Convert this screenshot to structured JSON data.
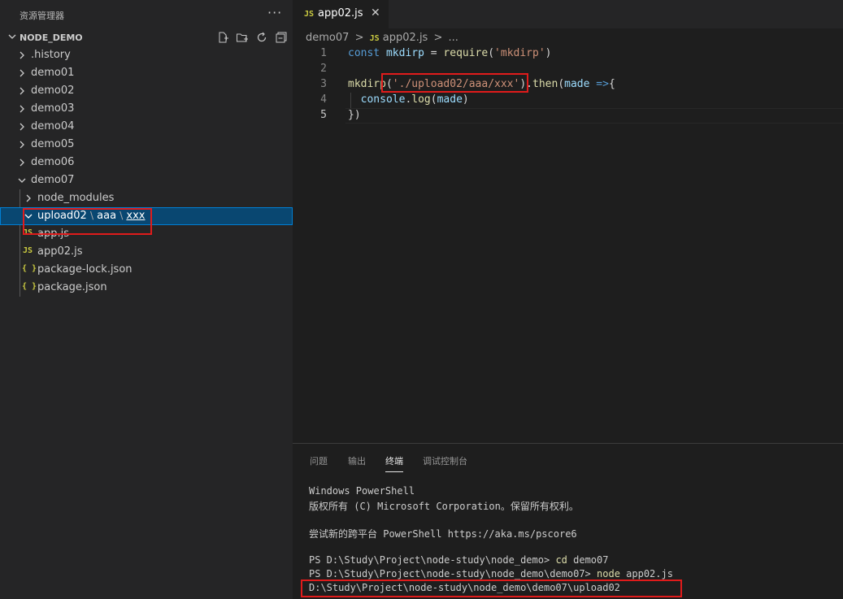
{
  "sidebar": {
    "title": "资源管理器",
    "more": "···",
    "section_title": "NODE_DEMO",
    "actions": [
      "new-file-icon",
      "new-folder-icon",
      "refresh-icon",
      "collapse-all-icon"
    ],
    "items": [
      {
        "label": ".history",
        "type": "folder",
        "expanded": false
      },
      {
        "label": "demo01",
        "type": "folder",
        "expanded": false
      },
      {
        "label": "demo02",
        "type": "folder",
        "expanded": false
      },
      {
        "label": "demo03",
        "type": "folder",
        "expanded": false
      },
      {
        "label": "demo04",
        "type": "folder",
        "expanded": false
      },
      {
        "label": "demo05",
        "type": "folder",
        "expanded": false
      },
      {
        "label": "demo06",
        "type": "folder",
        "expanded": false
      },
      {
        "label": "demo07",
        "type": "folder",
        "expanded": true
      },
      {
        "label": "node_modules",
        "type": "folder",
        "expanded": false
      },
      {
        "label": "upload02",
        "sep1": "\\",
        "label2": "aaa",
        "sep2": "\\",
        "label3": "xxx",
        "type": "folder",
        "expanded": true,
        "selected": true
      },
      {
        "label": "app.js",
        "type": "file",
        "icon": "JS"
      },
      {
        "label": "app02.js",
        "type": "file",
        "icon": "JS"
      },
      {
        "label": "package-lock.json",
        "type": "file",
        "icon": "{ }"
      },
      {
        "label": "package.json",
        "type": "file",
        "icon": "{ }"
      }
    ]
  },
  "editor": {
    "tab": {
      "icon": "JS",
      "label": "app02.js",
      "close": "✕"
    },
    "breadcrumb": {
      "folder": "demo07",
      "sep": ">",
      "file_icon": "JS",
      "file": "app02.js",
      "sep2": ">",
      "more": "..."
    },
    "lines": [
      {
        "num": "1",
        "tokens": [
          [
            "kw",
            "const"
          ],
          [
            "punc",
            " "
          ],
          [
            "var",
            "mkdirp"
          ],
          [
            "punc",
            " = "
          ],
          [
            "fn",
            "require"
          ],
          [
            "punc",
            "("
          ],
          [
            "str",
            "'mkdirp'"
          ],
          [
            "punc",
            ")"
          ]
        ]
      },
      {
        "num": "2",
        "tokens": []
      },
      {
        "num": "3",
        "tokens": [
          [
            "fn",
            "mkdirp"
          ],
          [
            "punc",
            "("
          ],
          [
            "str",
            "'./upload02/aaa/xxx'"
          ],
          [
            "punc",
            ")."
          ],
          [
            "fn",
            "then"
          ],
          [
            "punc",
            "("
          ],
          [
            "var",
            "made"
          ],
          [
            "punc",
            " "
          ],
          [
            "kw",
            "=>"
          ],
          [
            "punc",
            "{"
          ]
        ]
      },
      {
        "num": "4",
        "tokens": [
          [
            "punc",
            "  "
          ],
          [
            "var",
            "console"
          ],
          [
            "punc",
            "."
          ],
          [
            "fn",
            "log"
          ],
          [
            "punc",
            "("
          ],
          [
            "var",
            "made"
          ],
          [
            "punc",
            ")"
          ]
        ]
      },
      {
        "num": "5",
        "tokens": [
          [
            "punc",
            "})"
          ]
        ]
      }
    ]
  },
  "panel": {
    "tabs": [
      "问题",
      "输出",
      "终端",
      "调试控制台"
    ],
    "active_tab": 2,
    "terminal": [
      {
        "text": "Windows PowerShell"
      },
      {
        "text": "版权所有 (C) Microsoft Corporation。保留所有权利。"
      },
      {
        "text": ""
      },
      {
        "text": "尝试新的跨平台 PowerShell https://aka.ms/pscore6"
      },
      {
        "text": ""
      },
      {
        "prompt": "PS D:\\Study\\Project\\node-study\\node_demo> ",
        "cmd": "cd",
        "rest": " demo07"
      },
      {
        "prompt": "PS D:\\Study\\Project\\node-study\\node_demo\\demo07> ",
        "cmd": "node",
        "rest": " app02.js"
      },
      {
        "text": "D:\\Study\\Project\\node-study\\node_demo\\demo07\\upload02"
      }
    ]
  },
  "colors": {
    "highlight": "#e01b1b",
    "selection": "#094771",
    "accent": "#007fd4"
  }
}
